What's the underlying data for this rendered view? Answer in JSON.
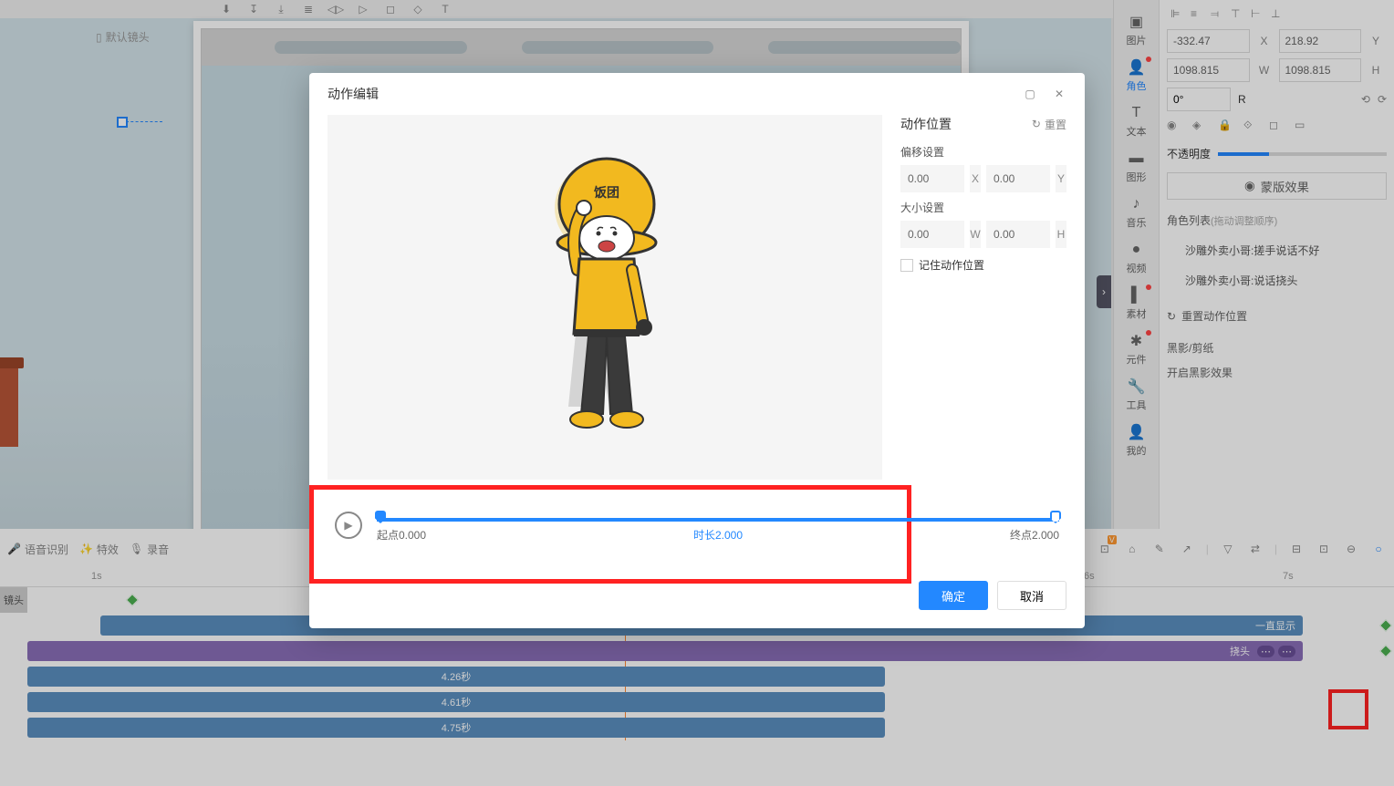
{
  "toolbar_icons": [
    "⬇",
    "↧",
    "⤓",
    "≡",
    "⟲",
    "▷",
    "◻",
    "⬡",
    "T",
    "—",
    "⊞",
    "⌧",
    "⊡",
    "◫",
    "⫴",
    "⋯",
    "◐",
    "◑",
    "+",
    "−",
    "⊘",
    "⊞",
    "⋮",
    "▭",
    "▭"
  ],
  "canvas": {
    "default_lens": "默认镜头"
  },
  "asset_sidebar": {
    "items": [
      {
        "icon": "▣",
        "label": "图片",
        "dot": false
      },
      {
        "icon": "👤",
        "label": "角色",
        "dot": true,
        "active": true
      },
      {
        "icon": "T",
        "label": "文本",
        "dot": false
      },
      {
        "icon": "◆",
        "label": "图形",
        "dot": false
      },
      {
        "icon": "♪",
        "label": "音乐",
        "dot": false
      },
      {
        "icon": "▶",
        "label": "视频",
        "dot": false
      },
      {
        "icon": "📁",
        "label": "素材",
        "dot": true
      },
      {
        "icon": "✱",
        "label": "元件",
        "dot": true
      },
      {
        "icon": "🔧",
        "label": "工具",
        "dot": false
      },
      {
        "icon": "👤",
        "label": "我的",
        "dot": false
      }
    ]
  },
  "props": {
    "x": "-332.47",
    "x_lbl": "X",
    "y": "218.92",
    "y_lbl": "Y",
    "w": "1098.815",
    "w_lbl": "W",
    "h": "1098.815",
    "h_lbl": "H",
    "r": "0°",
    "r_lbl": "R",
    "opacity_label": "不透明度",
    "mask_btn": "蒙版效果",
    "char_list_title": "角色列表",
    "char_list_sub": "(拖动调整顺序)",
    "char1": "沙雕外卖小哥:搓手说话不好",
    "char2": "沙雕外卖小哥:说话挠头",
    "reset_pos": "重置动作位置",
    "shadow_title": "黑影/剪纸",
    "shadow_enable": "开启黑影效果"
  },
  "timeline": {
    "left_btns": [
      "语音识别",
      "特效",
      "录音"
    ],
    "ticks": [
      "1s",
      "6s",
      "7s"
    ],
    "track1_label": "镜头",
    "clip_always": "一直显示",
    "clip_head": "挠头",
    "dur1": "4.26秒",
    "dur2": "4.61秒",
    "dur3": "4.75秒"
  },
  "modal": {
    "title": "动作编辑",
    "pos_title": "动作位置",
    "reset": "重置",
    "offset_label": "偏移设置",
    "size_label": "大小设置",
    "x": "0.00",
    "y": "0.00",
    "w": "0.00",
    "h": "0.00",
    "remember": "记住动作位置",
    "start": "起点0.000",
    "duration": "时长2.000",
    "end": "终点2.000",
    "ok": "确定",
    "cancel": "取消",
    "char_text": "饭团"
  }
}
